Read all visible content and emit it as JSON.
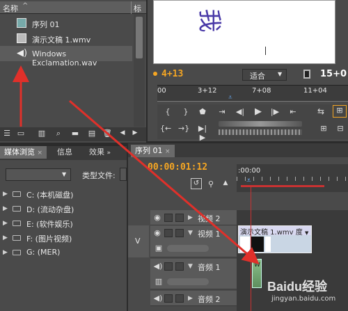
{
  "project_panel": {
    "col_name": "名称",
    "col_label": "标签",
    "items": [
      {
        "label": "序列 01",
        "icon": "sequence-icon"
      },
      {
        "label": "演示文稿 1.wmv",
        "icon": "video-file-icon"
      },
      {
        "label": "Windows Exclamation.wav",
        "icon": "audio-file-icon"
      }
    ]
  },
  "program_monitor": {
    "preview_text": "我",
    "timecode": "4+13",
    "fit_label": "适合",
    "duration": "15+0",
    "ruler": [
      "00",
      "3+12",
      "7+08",
      "11+04"
    ]
  },
  "media_browser": {
    "tabs": [
      "媒体浏览",
      "信息",
      "效果"
    ],
    "file_type_label": "类型文件:",
    "drives": [
      "C: (本机磁盘)",
      "D: (流动杂盘)",
      "E: (软件娱乐)",
      "F: (图片视频)",
      "G: (MER)"
    ]
  },
  "timeline": {
    "tab_label": "序列 01",
    "timecode": "00:00:01:12",
    "ruler_start": ":00:00",
    "track_v": "V",
    "tracks": [
      {
        "name": "视频 2"
      },
      {
        "name": "视频 1"
      },
      {
        "name": "音频 1"
      },
      {
        "name": "音频 2"
      }
    ],
    "clip_label": "演示文稿 1.wmv",
    "clip_suffix": "度",
    "audio_clip_label": "W"
  },
  "watermark": {
    "brand": "Baidu经验",
    "url": "jingyan.baidu.com"
  },
  "colors": {
    "accent": "#f5a623",
    "arrow": "#e0302a",
    "playhead": "#c83232"
  }
}
